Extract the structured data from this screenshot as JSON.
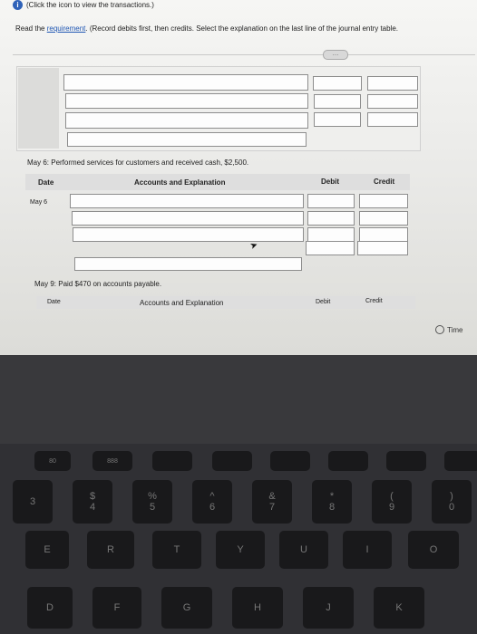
{
  "header": {
    "info_text": "(Click the icon to view the transactions.)",
    "instructions_prefix": "Read the ",
    "requirement_link": "requirement",
    "instructions_suffix": ". (Record debits first, then credits. Select the explanation on the last line of the journal entry table.",
    "more_pill": "…"
  },
  "entry_may6": {
    "description": "May 6: Performed services for customers and received cash, $2,500.",
    "headers": {
      "date": "Date",
      "accounts": "Accounts and Explanation",
      "debit": "Debit",
      "credit": "Credit"
    },
    "date_value": "May 6"
  },
  "entry_may9": {
    "description": "May 9: Paid $470 on accounts payable.",
    "headers": {
      "date": "Date",
      "accounts": "Accounts and Explanation",
      "debit": "Debit",
      "credit": "Credit"
    }
  },
  "timer": {
    "label": "Time"
  },
  "keyboard": {
    "fn_keys": [
      "80",
      "888",
      "",
      "",
      "",
      "",
      "",
      "",
      "",
      "",
      ""
    ],
    "number_row": [
      "3",
      "4",
      "5",
      "6",
      "7",
      "8",
      "9",
      "0"
    ],
    "number_symbols": [
      "#",
      "$",
      "%",
      "^",
      "&",
      "*",
      "(",
      ")"
    ],
    "row_qwerty": [
      "E",
      "R",
      "T",
      "Y",
      "U",
      "I",
      "O"
    ],
    "row_home": [
      "D",
      "F",
      "G",
      "H",
      "J",
      "K"
    ]
  }
}
